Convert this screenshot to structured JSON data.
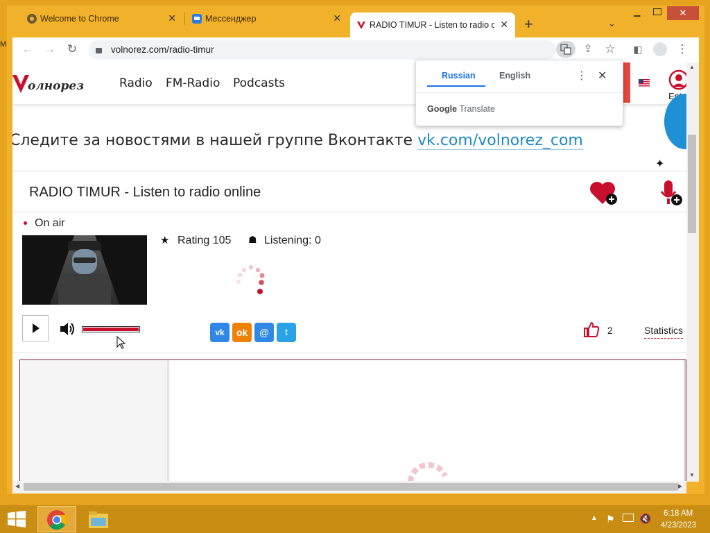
{
  "browser": {
    "tabs": [
      {
        "title": "Welcome to Chrome",
        "icon": "chrome-icon"
      },
      {
        "title": "Мессенджер",
        "icon": "messenger-icon"
      },
      {
        "title": "RADIO TIMUR - Listen to radio o",
        "icon": "volnorez-icon"
      }
    ],
    "new_tab_label": "+",
    "url": "volnorez.com/radio-timur"
  },
  "translate_popup": {
    "lang_source": "Russian",
    "lang_target": "English",
    "brand_google": "Google",
    "brand_translate": "Translate"
  },
  "site": {
    "logo_text": "олнорез",
    "nav": [
      "Radio",
      "FM-Radio",
      "Podcasts"
    ],
    "enter_label": "Ente",
    "banner_text": "Следите за новостями в нашей группе Вконтакте",
    "banner_link": "vk.com/volnorez_com"
  },
  "station": {
    "title": "RADIO TIMUR - Listen to radio online",
    "status": "On air",
    "rating_label": "Rating 105",
    "listening_label": "Listening: 0",
    "likes": "2",
    "statistics_label": "Statistics",
    "share_buttons": [
      "vk",
      "ok",
      "mailru",
      "twitter"
    ]
  },
  "taskbar": {
    "time": "6:18 AM",
    "date": "4/23/2023"
  },
  "colors": {
    "accent": "#c8102e",
    "frame": "#f2b12a",
    "taskbar": "#c88d12"
  }
}
